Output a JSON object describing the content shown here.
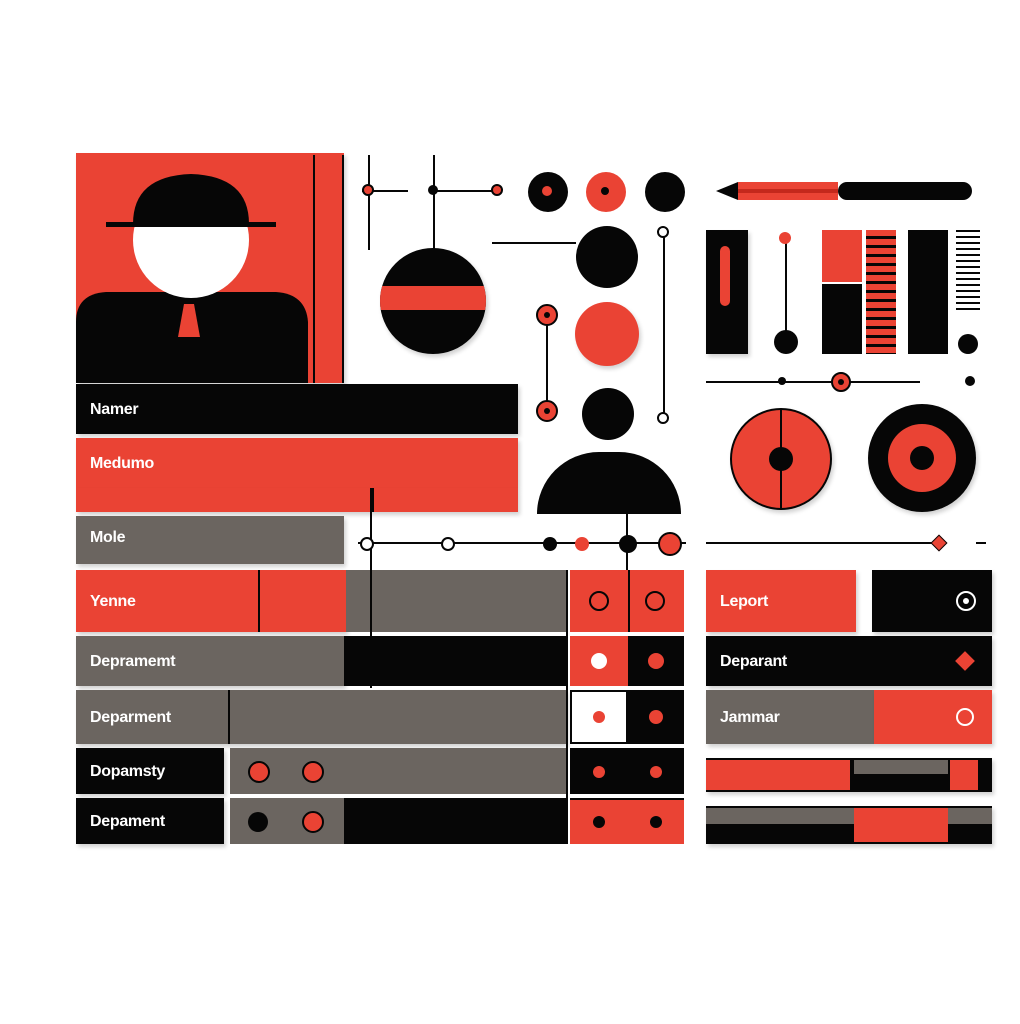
{
  "profile": {
    "rows": [
      {
        "label": "Namer"
      },
      {
        "label": "Medumo"
      },
      {
        "label": "Mole"
      },
      {
        "label": "Yenne"
      },
      {
        "label": "Depramemt"
      },
      {
        "label": "Deparment"
      },
      {
        "label": "Dopamsty"
      },
      {
        "label": "Depament"
      }
    ]
  },
  "right_panel": {
    "rows": [
      {
        "label": "Leport"
      },
      {
        "label": "Deparant"
      },
      {
        "label": "Jammar"
      }
    ]
  },
  "colors": {
    "accent_red": "#ea4334",
    "black": "#060606",
    "gray": "#6b6560",
    "background": "#ffffff"
  },
  "icons": [
    "user-avatar-icon",
    "pencil-icon",
    "radio-icon",
    "diamond-icon",
    "circle-icon"
  ]
}
